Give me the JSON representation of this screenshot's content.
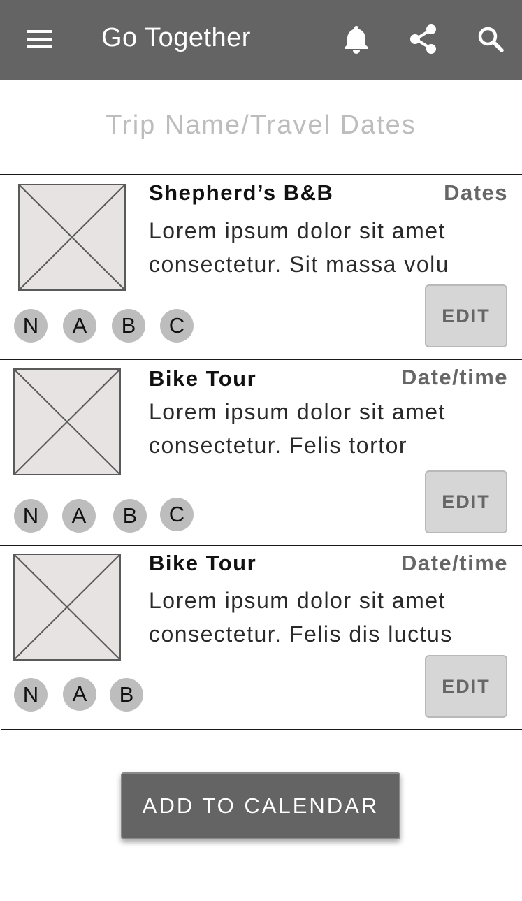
{
  "appbar": {
    "title": "Go Together",
    "icons": [
      "menu-icon",
      "bell-icon",
      "share-icon",
      "search-icon"
    ],
    "background": "#646464"
  },
  "subtitle": "Trip Name/Travel Dates",
  "cards": [
    {
      "name": "Shepherd’s B&B",
      "date": "Dates",
      "desc_line1": "Lorem ipsum dolor sit amet",
      "desc_line2": "consectetur. Sit massa volu",
      "edit_label": "EDIT",
      "avatars": [
        "N",
        "A",
        "B",
        "C"
      ]
    },
    {
      "name": "Bike Tour",
      "date": "Date/time",
      "desc_line1": "Lorem ipsum dolor sit amet",
      "desc_line2": "consectetur. Felis tortor",
      "edit_label": "EDIT",
      "avatars": [
        "N",
        "A",
        "B",
        "C"
      ]
    },
    {
      "name": "Bike Tour",
      "date": "Date/time",
      "desc_line1": "Lorem ipsum dolor sit amet",
      "desc_line2": "consectetur. Felis dis luctus",
      "edit_label": "EDIT",
      "avatars": [
        "N",
        "A",
        "B"
      ]
    }
  ],
  "cta": {
    "label": "ADD TO CALENDAR"
  },
  "colors": {
    "appbar": "#646464",
    "placeholder_fill": "#e6e3e2",
    "avatar": "#bdbdbd",
    "edit_button": "#d6d6d6"
  }
}
